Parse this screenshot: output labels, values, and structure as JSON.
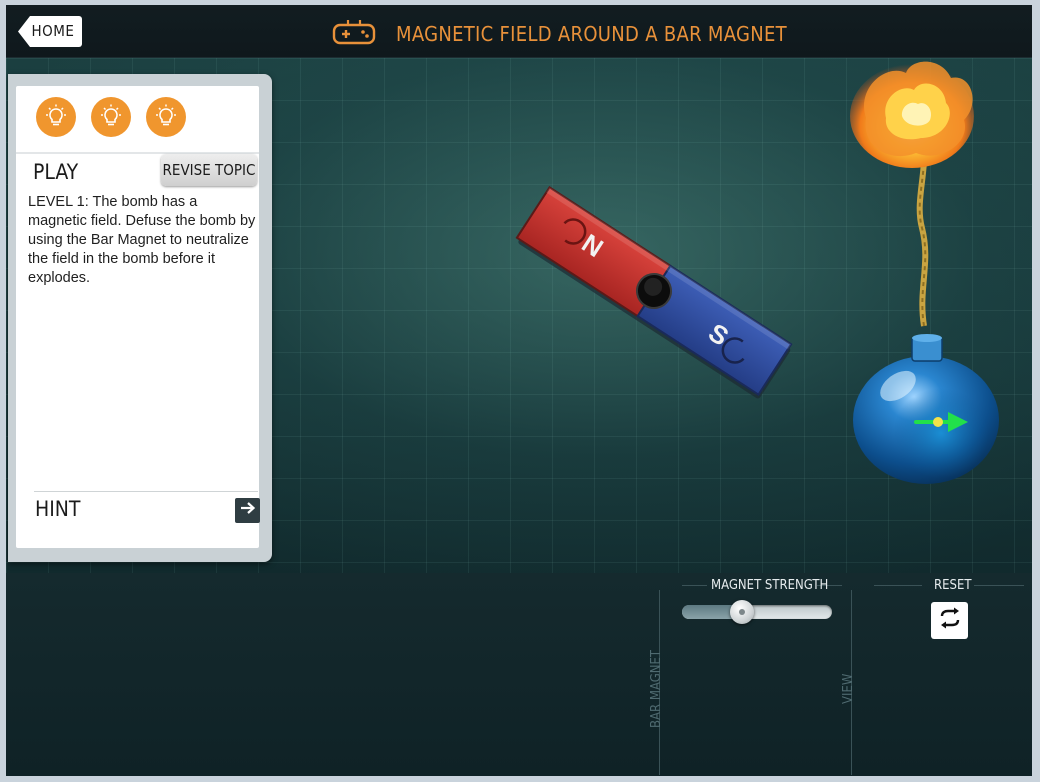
{
  "header": {
    "home_label": "HOME",
    "title": "MAGNETIC FIELD AROUND A BAR MAGNET",
    "title_icon": "gamepad-icon"
  },
  "panel": {
    "hints_icons": [
      "lightbulb-icon",
      "lightbulb-icon",
      "lightbulb-icon"
    ],
    "play_label": "PLAY",
    "revise_label": "REVISE TOPIC",
    "level_text": "LEVEL 1: The bomb has a magnetic field. Defuse the bomb by using the Bar Magnet to neutralize the field in the bomb before it explodes.",
    "hint_label": "HINT",
    "hint_icon": "arrow-right-icon"
  },
  "magnet": {
    "north_label": "N",
    "south_label": "S",
    "north_color": "#c8322e",
    "south_color": "#2f4fa3"
  },
  "bomb": {
    "field_arrow_color": "#22e04a",
    "body_color": "#0e5fa6"
  },
  "controls": {
    "magnet_strength_label": "MAGNET STRENGTH",
    "magnet_strength_value": 0.4,
    "reset_label": "RESET",
    "reset_icon": "refresh-icon",
    "bar_magnet_label": "BAR MAGNET",
    "view_label": "VIEW"
  },
  "colors": {
    "accent_orange": "#e8913a",
    "bulb_orange": "#f0962e"
  }
}
